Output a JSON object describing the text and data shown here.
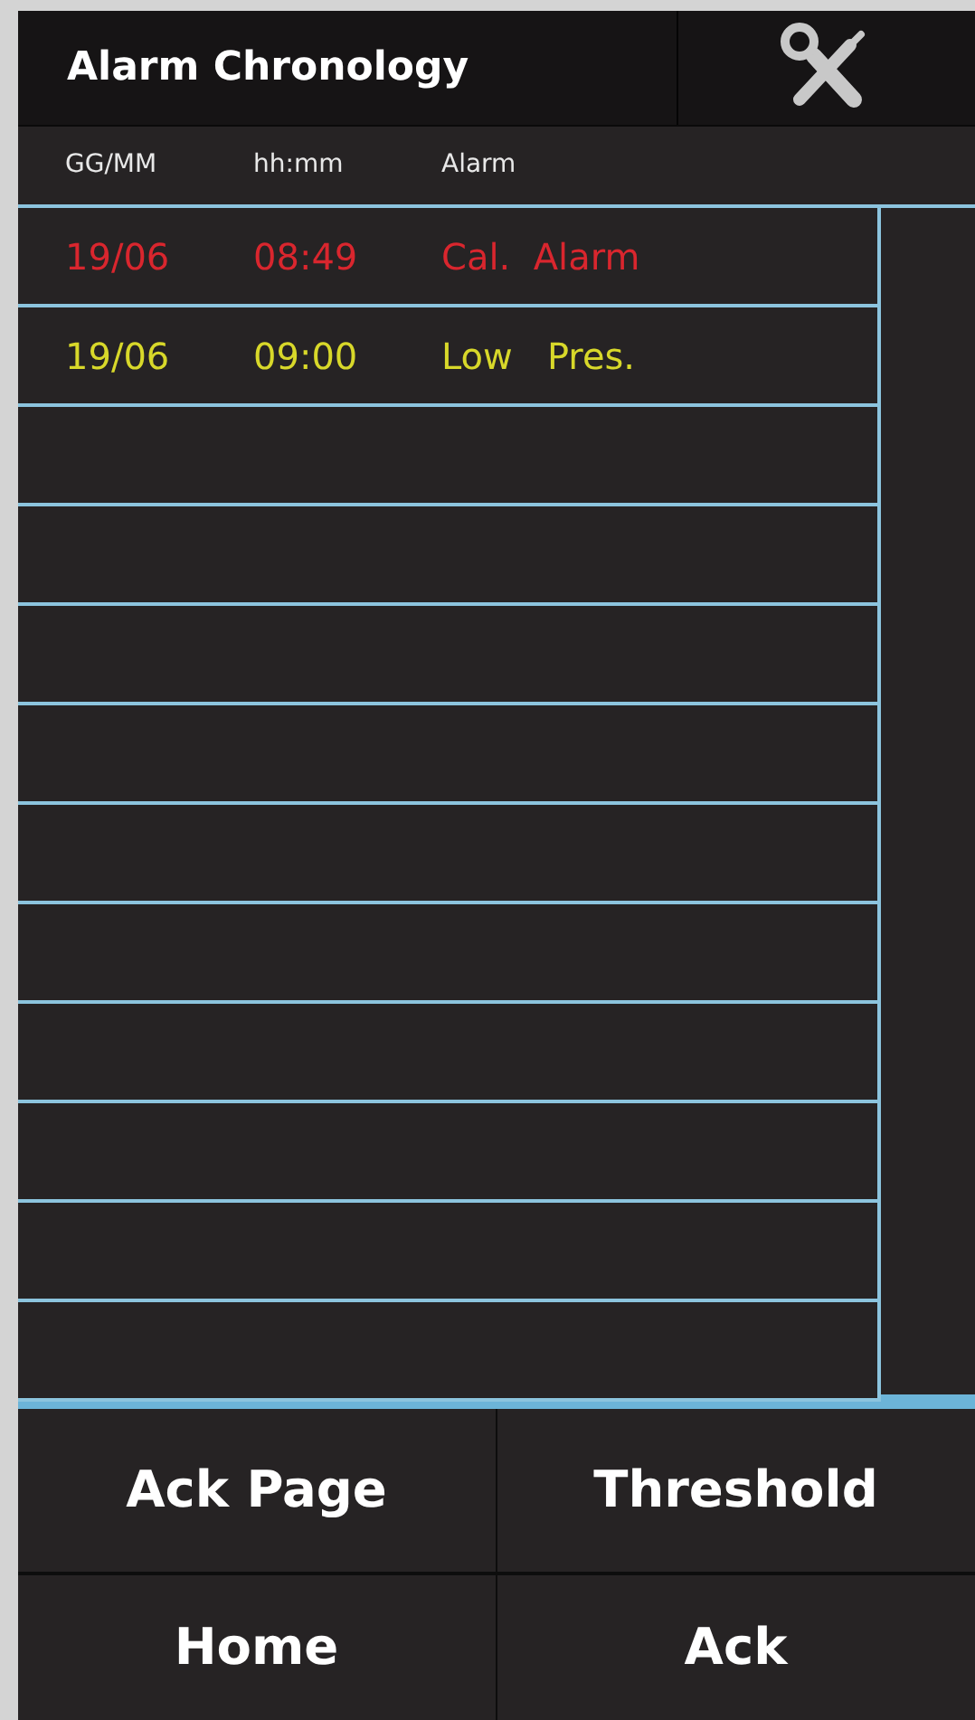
{
  "header": {
    "title": "Alarm Chronology"
  },
  "columns": [
    "GG/MM",
    "hh:mm",
    "Alarm"
  ],
  "rows": [
    {
      "date": "19/06",
      "time": "08:49",
      "alarm": "Cal.  Alarm",
      "color": "#d9262e"
    },
    {
      "date": "19/06",
      "time": "09:00",
      "alarm": "Low   Pres.",
      "color": "#d8d82a"
    }
  ],
  "buttons": [
    "Ack Page",
    "Threshold",
    "Home",
    "Ack"
  ]
}
